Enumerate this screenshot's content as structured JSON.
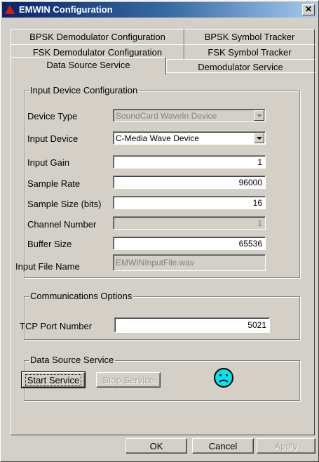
{
  "window": {
    "title": "EMWIN Configuration",
    "close_symbol": "✕"
  },
  "tabs": {
    "row1": [
      "BPSK Demodulator Configuration",
      "BPSK Symbol Tracker"
    ],
    "row2": [
      "FSK Demodulator Configuration",
      "FSK Symbol Tracker"
    ],
    "row3": [
      "Data Source Service",
      "Demodulator Service"
    ],
    "active": "Data Source Service"
  },
  "input_device_config": {
    "title": "Input Device Configuration",
    "device_type": {
      "label": "Device Type",
      "value": "SoundCard WaveIn Device"
    },
    "input_device": {
      "label": "Input Device",
      "value": "C-Media Wave Device"
    },
    "input_gain": {
      "label": "Input Gain",
      "value": "1"
    },
    "sample_rate": {
      "label": "Sample Rate",
      "value": "96000"
    },
    "sample_size": {
      "label": "Sample Size (bits)",
      "value": "16"
    },
    "channel_number": {
      "label": "Channel Number",
      "value": "1"
    },
    "buffer_size": {
      "label": "Buffer Size",
      "value": "65536"
    },
    "input_file_name": {
      "label": "Input File Name",
      "value": "EMWINInputFile.wav"
    }
  },
  "comm_options": {
    "title": "Communications Options",
    "tcp_port": {
      "label": "TCP Port Number",
      "value": "5021"
    }
  },
  "data_source_service": {
    "title": "Data Source Service",
    "start_label": "Start Service",
    "stop_label": "Stop Service",
    "status_icon": "sad-face-icon",
    "status_color": "#00e5f0"
  },
  "footer": {
    "ok": "OK",
    "cancel": "Cancel",
    "apply": "Apply"
  }
}
